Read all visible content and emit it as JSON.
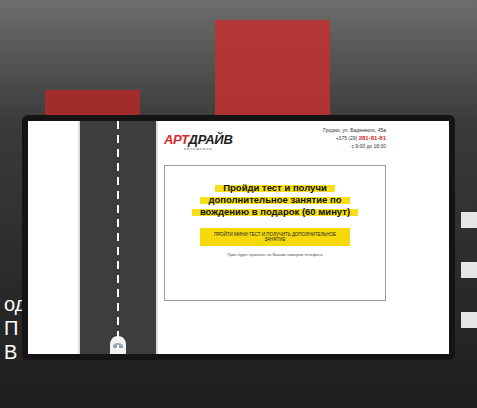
{
  "background": {
    "lines": [
      "од",
      "П",
      "В"
    ]
  },
  "logo": {
    "parts": [
      "АРТ",
      "ДРАЙВ"
    ],
    "subtitle": "автошкола"
  },
  "contacts": {
    "address": "Гродно, ул. Баденного, 45а",
    "phone_prefix": "+375 (29)",
    "phone": "281-81-81",
    "hours": "с 9:00 до 18:00"
  },
  "promo": {
    "heading": [
      "Пройди тест и получи",
      "дополнительное занятие по",
      "вождению в подарок (60 минут)"
    ],
    "button": "ПРОЙТИ МИНИ-ТЕСТ И ПОЛУЧИТЬ ДОПОЛНИТЕЛЬНОЕ ЗАНЯТИЕ",
    "note": "Приз будет привязан за Вашим номером телефона"
  }
}
